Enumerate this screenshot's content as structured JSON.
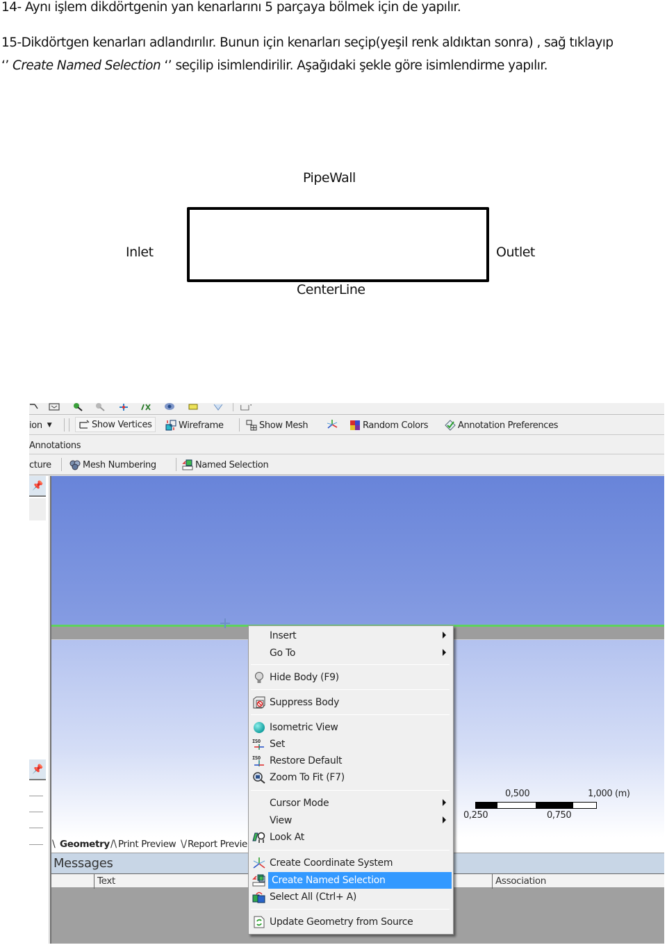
{
  "document": {
    "line14": "14- Aynı işlem dikdörtgenin yan kenarlarını 5 parçaya bölmek için de yapılır.",
    "line15a": "15-Dikdörtgen kenarları adlandırılır. Bunun için kenarları seçip(yeşil renk aldıktan sonra) , sağ tıklayıp",
    "line15b_quote_open": "‘’ ",
    "line15b_italic": "Create Named Selection",
    "line15b_quote_close": "  ‘’ ",
    "line15b_rest": "seçilip isimlendirilir. Aşağıdaki şekle göre isimlendirme yapılır."
  },
  "diagram": {
    "top_label": "PipeWall",
    "left_label": "Inlet",
    "right_label": "Outlet",
    "bottom_label": "CenterLine"
  },
  "app": {
    "top_icons": [
      "zoom-box-icon",
      "zoom-fit-icon",
      "zoom-in-icon",
      "zoom-out-icon",
      "pan-icon",
      "rotate-icon",
      "look-at-icon",
      "ruler-icon",
      "box-select-icon",
      "select-mode-icon"
    ],
    "toolbar1": {
      "truncated_dropdown": "ion",
      "show_vertices": "Show Vertices",
      "wireframe": "Wireframe",
      "show_mesh": "Show Mesh",
      "random_colors": "Random Colors",
      "annotation_preferences": "Annotation Preferences"
    },
    "toolbar2": {
      "annotations": "Annotations"
    },
    "toolbar3": {
      "truncated_structure": "cture",
      "mesh_numbering": "Mesh Numbering",
      "named_selection": "Named Selection"
    },
    "left_panel": {
      "pin_icon": "pin-icon"
    },
    "viewport": {
      "selection_color": "#5dd35d",
      "background_top": "#6884d9",
      "scale_bar": {
        "labels_top": [
          "0,500",
          "1,000 (m)"
        ],
        "labels_bottom": [
          "0,250",
          "0,750"
        ]
      }
    },
    "view_tabs": {
      "geometry": "Geometry",
      "print_preview": "Print Preview",
      "report_preview": "Report Previe"
    },
    "messages": {
      "title": "Messages",
      "columns": [
        "Text",
        "Association"
      ]
    },
    "context_menu": {
      "highlight_color": "#3399ff",
      "items": [
        {
          "label": "Insert",
          "submenu": true
        },
        {
          "label": "Go To",
          "submenu": true
        },
        {
          "label": "Hide Body (F9)",
          "icon": "lightbulb-icon"
        },
        {
          "label": "Suppress Body",
          "icon": "suppress-body-icon"
        },
        {
          "label": "Isometric View",
          "icon": "sphere-icon"
        },
        {
          "label": "Set",
          "icon": "iso-set-icon"
        },
        {
          "label": "Restore Default",
          "icon": "iso-restore-icon"
        },
        {
          "label": "Zoom To Fit (F7)",
          "icon": "zoom-fit-icon"
        },
        {
          "label": "Cursor Mode",
          "submenu": true
        },
        {
          "label": "View",
          "submenu": true
        },
        {
          "label": "Look At",
          "icon": "look-at-icon"
        },
        {
          "label": "Create Coordinate System",
          "icon": "coordinate-system-icon"
        },
        {
          "label": "Create Named Selection",
          "icon": "named-selection-icon",
          "selected": true
        },
        {
          "label": "Select All (Ctrl+ A)",
          "icon": "select-all-icon"
        },
        {
          "label": "Update Geometry from Source",
          "icon": "update-geometry-icon"
        }
      ]
    }
  }
}
